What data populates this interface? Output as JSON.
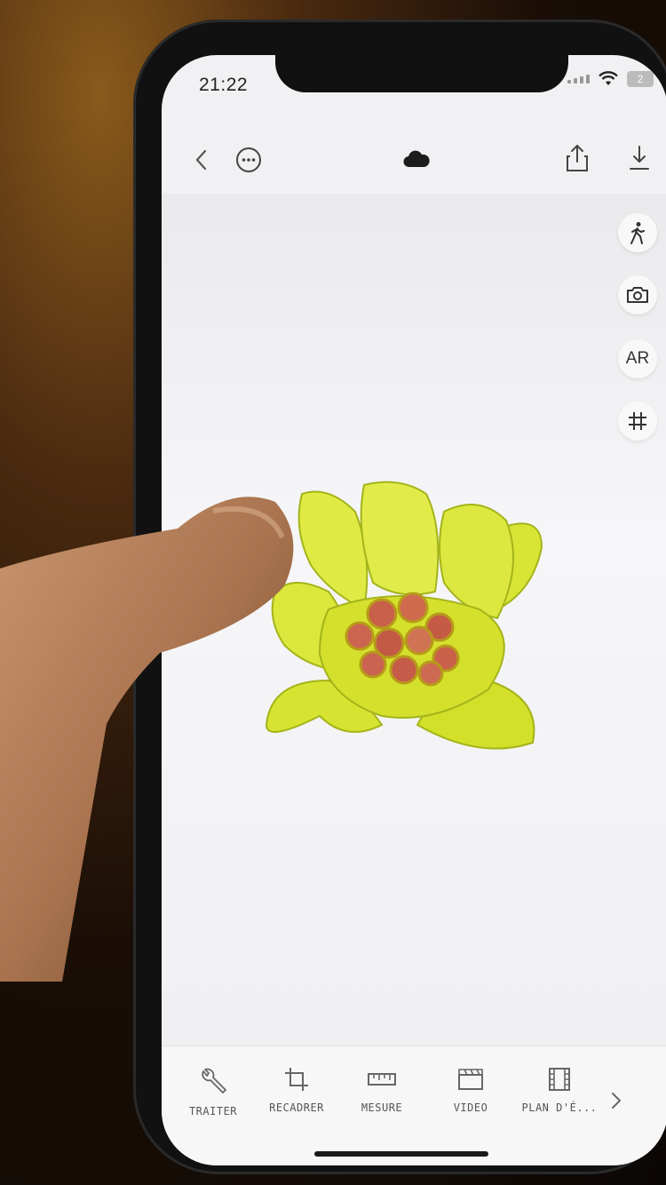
{
  "status_bar": {
    "time": "21:22",
    "battery": "2"
  },
  "top_toolbar": {
    "back_icon": "chevron-left-icon",
    "more_icon": "ellipsis-circle-icon",
    "cloud_icon": "cloud-icon",
    "share_icon": "share-icon",
    "download_icon": "download-icon"
  },
  "side_controls": {
    "walk_icon": "walk-icon",
    "camera_icon": "camera-icon",
    "ar_label": "AR",
    "grid_icon": "grid-icon"
  },
  "model": {
    "subject": "yellow-flower-3d-model",
    "color": "#d9e632",
    "center_color": "#c9604a"
  },
  "bottom_tools": [
    {
      "label": "TRAITER",
      "icon": "wrench-icon"
    },
    {
      "label": "RECADRER",
      "icon": "crop-icon"
    },
    {
      "label": "MESURE",
      "icon": "ruler-icon"
    },
    {
      "label": "VIDEO",
      "icon": "clapperboard-icon"
    },
    {
      "label": "PLAN D'É...",
      "icon": "film-icon"
    }
  ],
  "bottom_more_icon": "chevron-right-icon",
  "colors": {
    "screen_bg": "#f1f1f3",
    "accent": "#d9e632"
  }
}
